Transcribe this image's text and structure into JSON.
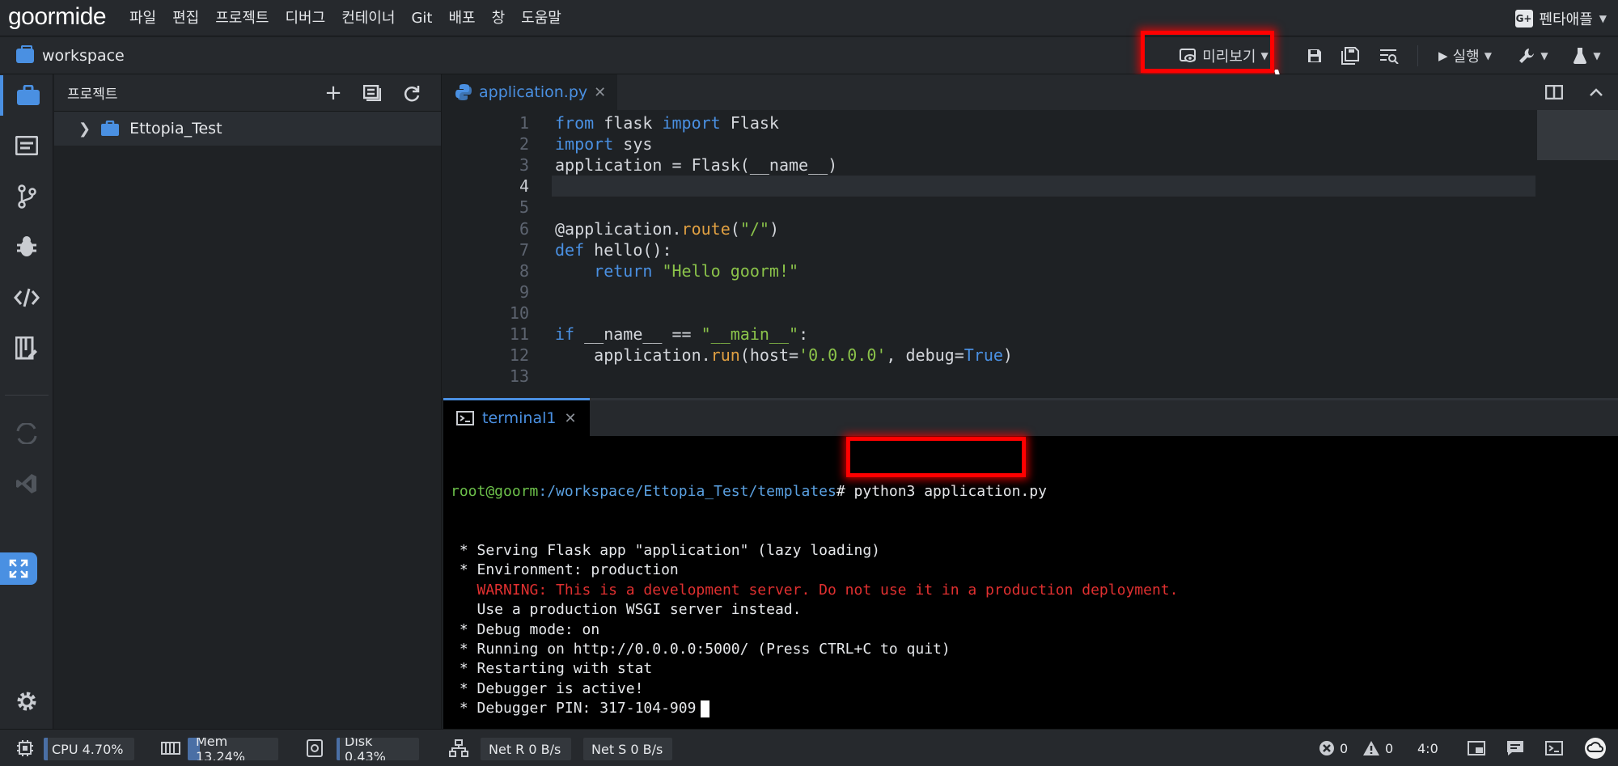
{
  "app": {
    "logo": "goormide"
  },
  "menu": {
    "items": [
      "파일",
      "편집",
      "프로젝트",
      "디버그",
      "컨테이너",
      "Git",
      "배포",
      "창",
      "도움말"
    ],
    "user": "펜타애플"
  },
  "toolbar": {
    "workspace": "workspace",
    "preview_label": "미리보기",
    "run_label": "실행"
  },
  "project_panel": {
    "title": "프로젝트",
    "tree": [
      {
        "label": "Ettopia_Test"
      }
    ]
  },
  "editor": {
    "tab": "application.py",
    "lines": [
      {
        "n": "1",
        "text": "from flask import Flask"
      },
      {
        "n": "2",
        "text": "import sys"
      },
      {
        "n": "3",
        "text": "application = Flask(__name__)"
      },
      {
        "n": "4",
        "text": ""
      },
      {
        "n": "5",
        "text": ""
      },
      {
        "n": "6",
        "text": "@application.route(\"/\")"
      },
      {
        "n": "7",
        "text": "def hello():"
      },
      {
        "n": "8",
        "text": "    return \"Hello goorm!\""
      },
      {
        "n": "9",
        "text": ""
      },
      {
        "n": "10",
        "text": ""
      },
      {
        "n": "11",
        "text": "if __name__ == \"__main__\":"
      },
      {
        "n": "12",
        "text": "    application.run(host='0.0.0.0', debug=True)"
      },
      {
        "n": "13",
        "text": ""
      }
    ],
    "active_line": "4"
  },
  "terminal": {
    "tab": "terminal1",
    "prompt_user": "root@goorm",
    "prompt_path": ":/workspace/Ettopia_Test/templates",
    "prompt_symbol": "#",
    "command": " python3 application.py",
    "output": [
      {
        "text": " * Serving Flask app \"application\" (lazy loading)",
        "color": "#e6e8eb"
      },
      {
        "text": " * Environment: production",
        "color": "#e6e8eb"
      },
      {
        "text": "   WARNING: This is a development server. Do not use it in a production deployment.",
        "color": "#e03030"
      },
      {
        "text": "   Use a production WSGI server instead.",
        "color": "#e6e8eb"
      },
      {
        "text": " * Debug mode: on",
        "color": "#e6e8eb"
      },
      {
        "text": " * Running on http://0.0.0.0:5000/ (Press CTRL+C to quit)",
        "color": "#e6e8eb"
      },
      {
        "text": " * Restarting with stat",
        "color": "#e6e8eb"
      },
      {
        "text": " * Debugger is active!",
        "color": "#e6e8eb"
      },
      {
        "text": " * Debugger PIN: 317-104-909",
        "color": "#e6e8eb"
      }
    ]
  },
  "status": {
    "cpu": "CPU 4.70%",
    "cpu_fraction": 0.047,
    "mem": "Mem 13.24%",
    "mem_fraction": 0.1324,
    "disk": "Disk 0.43%",
    "disk_fraction": 0.0043,
    "net_r": "Net R 0 B/s",
    "net_s": "Net S 0 B/s",
    "errors": "0",
    "warnings": "0",
    "cursor_pos": "4:0"
  },
  "colors": {
    "accent": "#4a90e2",
    "highlight": "#ff0000",
    "keyword": "#4a90e2",
    "function": "#e0a042",
    "string": "#8bc34a"
  }
}
